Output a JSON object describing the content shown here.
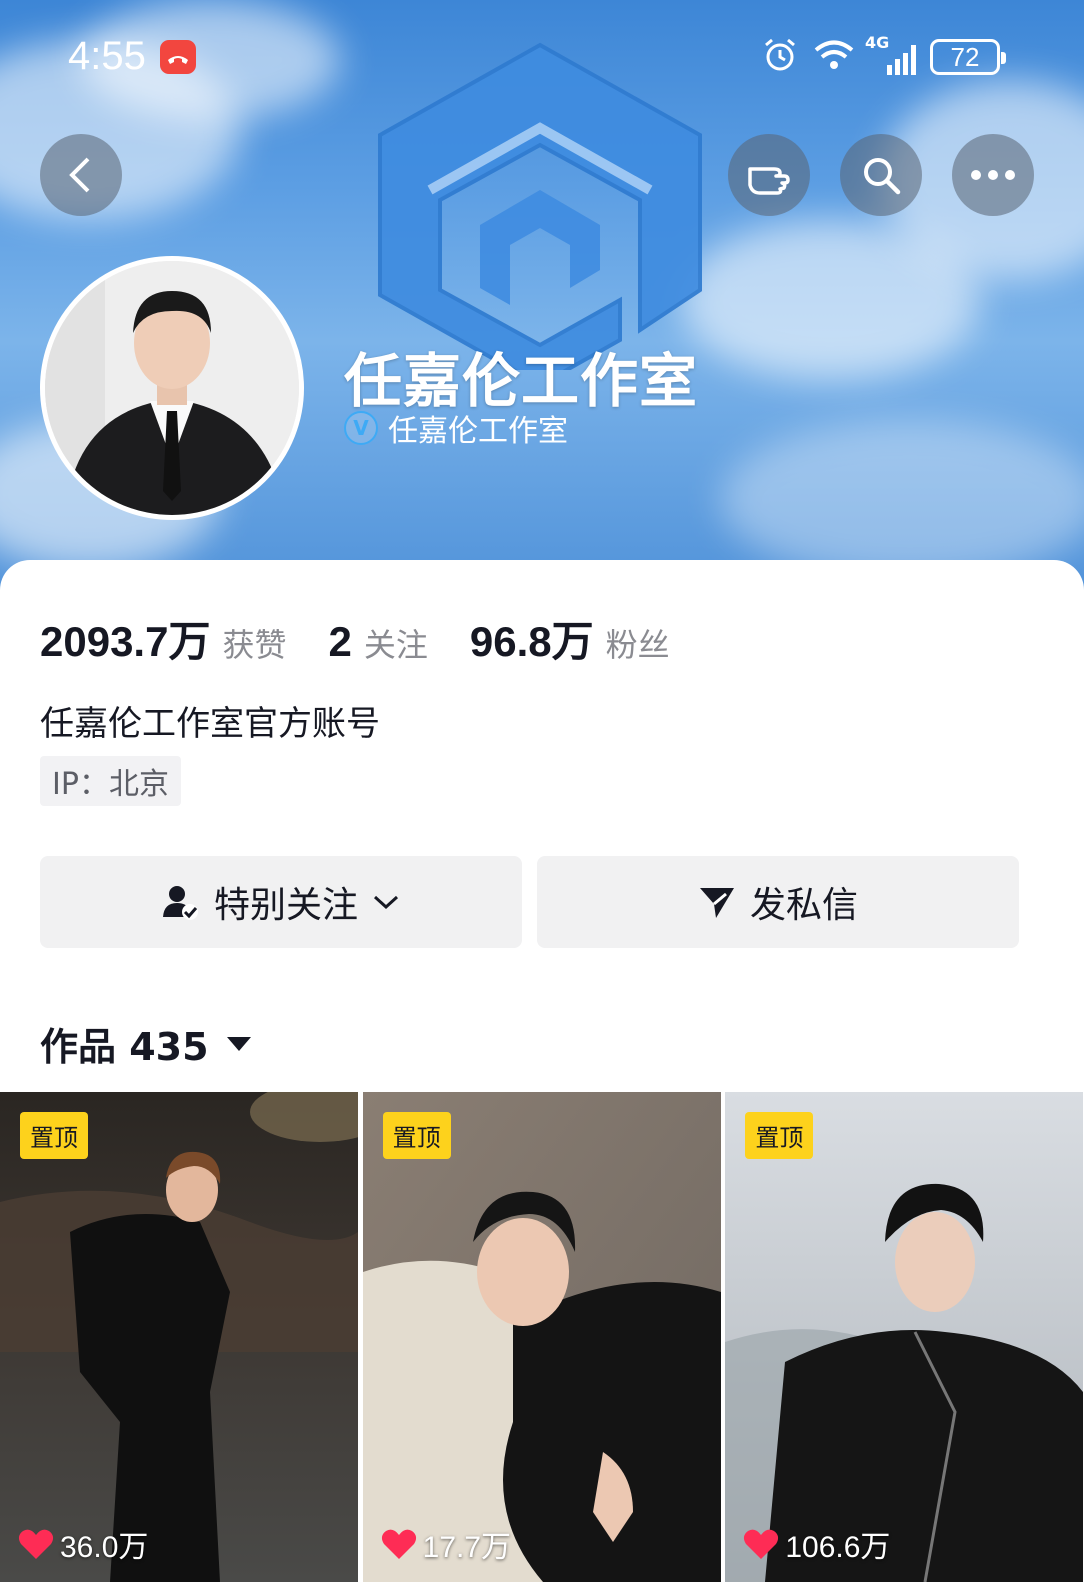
{
  "status_bar": {
    "time": "4:55",
    "network": "4G",
    "battery": "72"
  },
  "profile": {
    "name": "任嘉伦工作室",
    "verified_label": "任嘉伦工作室",
    "bio": "任嘉伦工作室官方账号",
    "ip": "IP：北京"
  },
  "stats": [
    {
      "value": "2093.7万",
      "label": "获赞"
    },
    {
      "value": "2",
      "label": "关注"
    },
    {
      "value": "96.8万",
      "label": "粉丝"
    }
  ],
  "actions": {
    "follow_label": "特别关注",
    "message_label": "发私信"
  },
  "works": {
    "label": "作品 435"
  },
  "videos": [
    {
      "pin": "置顶",
      "likes": "36.0万"
    },
    {
      "pin": "置顶",
      "likes": "17.7万"
    },
    {
      "pin": "置顶",
      "likes": "106.6万"
    }
  ],
  "colors": {
    "accent_pin": "#fdd21c",
    "like_heart": "#fe2c55",
    "banner": "#4c8fd8"
  }
}
